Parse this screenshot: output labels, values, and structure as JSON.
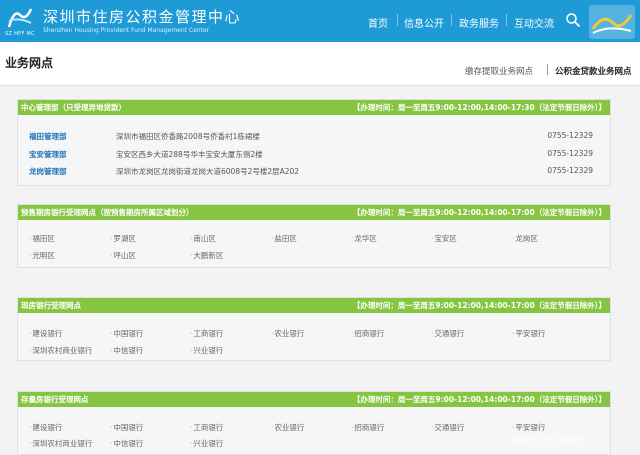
{
  "header": {
    "logo_caption": "SZ HPF MC",
    "title": "深圳市住房公积金管理中心",
    "subtitle": "Shenzhen Housing Provident Fund Management Center",
    "nav": [
      "首页",
      "信息公开",
      "政务服务",
      "互动交流"
    ]
  },
  "subbar": {
    "page_title": "业务网点",
    "tab_other": "缴存提取业务网点",
    "tab_active": "公积金贷款业务网点"
  },
  "sections": [
    {
      "title": "中心管理部（只受理异地贷款）",
      "hours": "【办理时间：周一至周五9:00-12:00,14:00-17:30（法定节假日除外）】",
      "departments": [
        {
          "name": "福田管理部",
          "address": "深圳市福田区侨香路2008号侨香村1栋裙楼",
          "phone": "0755-12329"
        },
        {
          "name": "宝安管理部",
          "address": "宝安区西乡大道288号华丰宝安大厦东侧2楼",
          "phone": "0755-12329"
        },
        {
          "name": "龙岗管理部",
          "address": "深圳市龙岗区龙岗街道龙岗大道6008号2号楼2层A202",
          "phone": "0755-12329"
        }
      ]
    },
    {
      "title": "预售期房银行受理网点（按预售期房所属区域划分）",
      "hours": "【办理时间：周一至周五9:00-12:00,14:00-17:00（法定节假日除外）】",
      "items": [
        "福田区",
        "罗湖区",
        "南山区",
        "盐田区",
        "宝安区",
        "龙岗区",
        "光明区",
        "坪山区",
        "大鹏新区",
        "龙华区"
      ]
    },
    {
      "title": "现房银行受理网点",
      "hours": "【办理时间：周一至周五9:00-12:00,14:00-17:00（法定节假日除外）】",
      "items": [
        "建设银行",
        "中国银行",
        "工商银行",
        "农业银行",
        "招商银行",
        "交通银行",
        "平安银行",
        "深圳农村商业银行",
        "中信银行",
        "兴业银行"
      ]
    },
    {
      "title": "存量房银行受理网点",
      "hours": "【办理时间：周一至周五9:00-12:00,14:00-17:00（法定节假日除外）】",
      "items": [
        "建设银行",
        "中国银行",
        "工商银行",
        "农业银行",
        "招商银行",
        "交通银行",
        "平安银行",
        "深圳农村商业银行",
        "中信银行",
        "兴业银行"
      ]
    }
  ],
  "watermark": "百家号/乐乐居士",
  "colors": {
    "header_blue": "#1e9ad6",
    "section_green": "#86c541",
    "dept_link_blue": "#2473b8"
  }
}
